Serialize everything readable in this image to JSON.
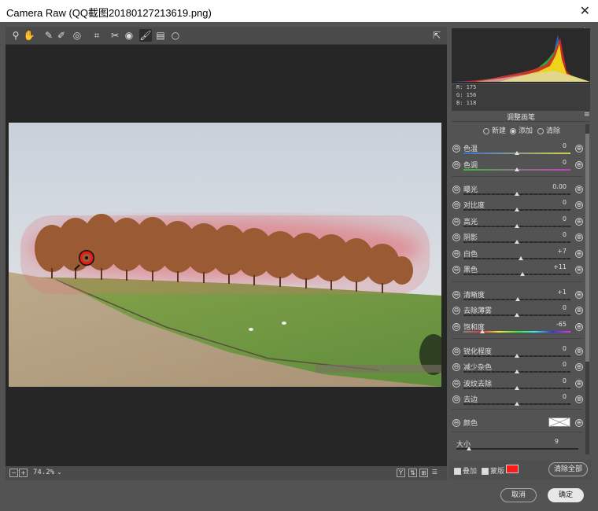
{
  "window": {
    "title": "Camera Raw (QQ截图20180127213619.png)",
    "close_glyph": "✕"
  },
  "toolbar": {
    "tools": [
      "search-icon",
      "hand-icon",
      "eyedropper-icon",
      "color-sampler-icon",
      "target-adjust-icon",
      "crop-icon",
      "spot-removal-icon",
      "redeye-icon",
      "brush-icon",
      "gradient-icon",
      "radial-icon"
    ],
    "glyphs": [
      "⚲",
      "✋",
      "✎",
      "✐",
      "◎",
      "⌗",
      "✂",
      "◉",
      "🖌",
      "▤",
      "○"
    ],
    "export_glyph": "⇱"
  },
  "status": {
    "zoom": "74.2%",
    "minus": "−",
    "plus": "+",
    "zoom_arrow": "⌄",
    "view_y": "Y",
    "view_icons": [
      "⇅",
      "⊞",
      "☰"
    ]
  },
  "readout": {
    "r": "R: 175",
    "g": "G: 156",
    "b": "B: 118"
  },
  "panel": {
    "title": "调整画笔",
    "modes": [
      {
        "label": "新建",
        "selected": false
      },
      {
        "label": "添加",
        "selected": true
      },
      {
        "label": "清除",
        "selected": false
      }
    ],
    "minus": "⊖",
    "plus": "⊕",
    "sliders": [
      {
        "label": "色温",
        "value": "0",
        "pos": 0.5,
        "track": "temp"
      },
      {
        "label": "色调",
        "value": "0",
        "pos": 0.5,
        "track": "tint"
      },
      {
        "label": "曝光",
        "value": "0.00",
        "pos": 0.5,
        "track": "plain"
      },
      {
        "label": "对比度",
        "value": "0",
        "pos": 0.5,
        "track": "plain"
      },
      {
        "label": "高光",
        "value": "0",
        "pos": 0.5,
        "track": "plain"
      },
      {
        "label": "阴影",
        "value": "0",
        "pos": 0.5,
        "track": "plain"
      },
      {
        "label": "白色",
        "value": "+7",
        "pos": 0.535,
        "track": "plain"
      },
      {
        "label": "黑色",
        "value": "+11",
        "pos": 0.555,
        "track": "plain"
      },
      {
        "label": "清晰度",
        "value": "+1",
        "pos": 0.505,
        "track": "plain"
      },
      {
        "label": "去除薄雾",
        "value": "0",
        "pos": 0.5,
        "track": "plain"
      },
      {
        "label": "饱和度",
        "value": "-65",
        "pos": 0.175,
        "track": "sat"
      },
      {
        "label": "锐化程度",
        "value": "0",
        "pos": 0.5,
        "track": "plain"
      },
      {
        "label": "减少杂色",
        "value": "0",
        "pos": 0.5,
        "track": "plain"
      },
      {
        "label": "波纹去除",
        "value": "0",
        "pos": 0.5,
        "track": "plain"
      },
      {
        "label": "去边",
        "value": "0",
        "pos": 0.5,
        "track": "plain"
      }
    ],
    "color_label": "颜色",
    "size_label": "大小",
    "size_value": "9",
    "size_pos": 0.1
  },
  "bottom": {
    "overlay_label": "叠加",
    "mask_label": "蒙版",
    "mask_color": "#ff1a1a",
    "clear_all": "清除全部"
  },
  "footer": {
    "cancel": "取消",
    "ok": "确定"
  },
  "colors": {
    "accent": "#ff1a1a",
    "panel_bg": "#535353",
    "canvas_bg": "#262626"
  }
}
